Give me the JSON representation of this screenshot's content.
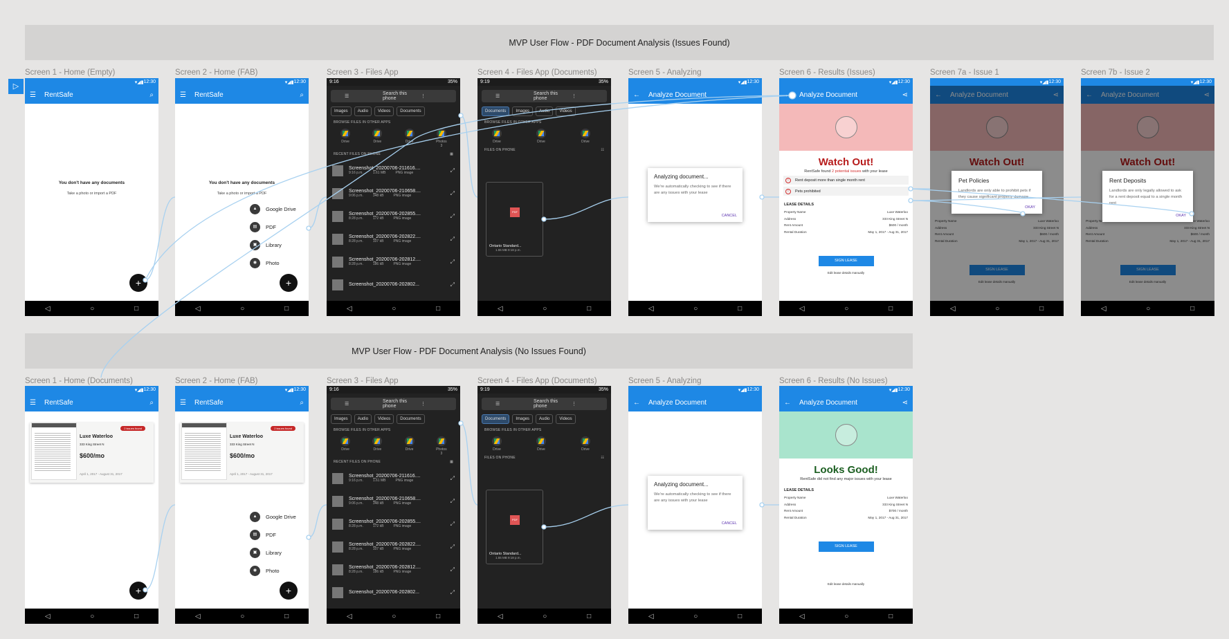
{
  "flow1_title": "MVP User Flow - PDF Document Analysis (Issues Found)",
  "flow2_title": "MVP User Flow - PDF Document Analysis (No Issues Found)",
  "labels_row1": [
    "Screen 1 - Home (Empty)",
    "Screen 2 - Home (FAB)",
    "Screen 3 - Files App",
    "Screen 4 - Files App (Documents)",
    "Screen 5 - Analyzing",
    "Screen 6 - Results (Issues)",
    "Screen 7a - Issue 1",
    "Screen 7b - Issue 2"
  ],
  "labels_row2": [
    "Screen 1 - Home (Documents)",
    "Screen 2 - Home (FAB)",
    "Screen 3 - Files App",
    "Screen 4 - Files App (Documents)",
    "Screen 5 - Analyzing",
    "Screen 6 - Results (No Issues)"
  ],
  "play_icon": "play-icon",
  "status": {
    "time": "12:30",
    "files_time": "9:16",
    "docs_time": "9:19",
    "battery": "35%"
  },
  "app": {
    "name": "RentSafe",
    "analyze_title": "Analyze Document"
  },
  "home": {
    "empty_title": "You don't have any documents",
    "empty_sub": "Take a photo or import a PDF",
    "fab": "+"
  },
  "fab_menu": [
    "Google Drive",
    "PDF",
    "Library",
    "Photo"
  ],
  "files": {
    "search": "Search this phone",
    "chips": [
      "Images",
      "Audio",
      "Videos",
      "Documents"
    ],
    "doc_chips": [
      "Documents",
      "Images",
      "Audio",
      "Videos"
    ],
    "browse": "BROWSE FILES IN OTHER APPS",
    "apps": [
      "Drive",
      "Drive",
      "Drive",
      "Photos"
    ],
    "apps_sub": "3",
    "doc_apps": [
      "Drive",
      "Drive",
      "Drive"
    ],
    "recent": "RECENT FILES ON PHONE",
    "files_on_phone": "FILES ON PHONE",
    "items": [
      {
        "name": "Screenshot_20200706-211616....",
        "time": "9:16 p.m.",
        "size": "1.61 MB",
        "type": "PNG image"
      },
      {
        "name": "Screenshot_20200706-210658....",
        "time": "9:06 p.m.",
        "size": "348 kB",
        "type": "PNG image"
      },
      {
        "name": "Screenshot_20200706-202855....",
        "time": "8:28 p.m.",
        "size": "172 kB",
        "type": "PNG image"
      },
      {
        "name": "Screenshot_20200706-202822....",
        "time": "8:28 p.m.",
        "size": "107 kB",
        "type": "PNG image"
      },
      {
        "name": "Screenshot_20200706-202812....",
        "time": "8:28 p.m.",
        "size": "186 kB",
        "type": "PNG image"
      },
      {
        "name": "Screenshot_20200706-202802...",
        "time": "",
        "size": "",
        "type": ""
      }
    ],
    "pdf_badge": "PDF",
    "pdf_name": "Ontario Standard...",
    "pdf_meta": "1.55 MB 9:18 p.m."
  },
  "analyzing": {
    "title": "Analyzing document...",
    "body": "We're automatically checking to see if there are any issues with your lease",
    "cancel": "CANCEL"
  },
  "results": {
    "watch": "Watch Out!",
    "found_pre": "RentSafe found ",
    "found_em": "2 potential issues",
    "found_post": " with your lease",
    "issues": [
      "Rent deposit more than single month rent",
      "Pets prohibited"
    ],
    "good": "Looks Good!",
    "good_sub": "RentSafe did not find any major issues with your lease",
    "lease_head": "LEASE DETAILS",
    "details": [
      [
        "Property Name",
        "Luxe Waterloo"
      ],
      [
        "Address",
        "333 King Street N"
      ],
      [
        "Rent Amount",
        "$600 / month"
      ],
      [
        "Rental Duration",
        "May 1, 2017 - Aug 31, 2017"
      ]
    ],
    "details2": [
      [
        "Property Name",
        "Luxe Waterloo"
      ],
      [
        "Address",
        "333 King Street N"
      ],
      [
        "Rent Amount",
        "$700 / month"
      ],
      [
        "Rental Duration",
        "May 1, 2017 - Aug 31, 2017"
      ]
    ],
    "sign": "SIGN LEASE",
    "edit": "Edit lease details manually"
  },
  "popups": {
    "a_title": "Pet Policies",
    "a_body": "Landlords are only able to prohibit pets if they cause significant property damage",
    "okay": "OKAY",
    "b_title": "Rent Deposits",
    "b_body": "Landlords are only legally allowed to ask for a rent deposit equal to a single month rent"
  },
  "card": {
    "badge": "2 issues found",
    "title": "Luxe Waterloo",
    "address": "333 King Street N",
    "price": "$600/mo",
    "dates": "April 1, 2017 - August 31, 2017",
    "doc_head": "LUXE"
  },
  "colors": {
    "blue": "#1e88e5",
    "red_hero": "#f4b9b9",
    "green_hero": "#a9e4cd",
    "canvas": "#e6e5e4",
    "banner": "#d4d3d2",
    "connector": "#a8d1f0"
  }
}
